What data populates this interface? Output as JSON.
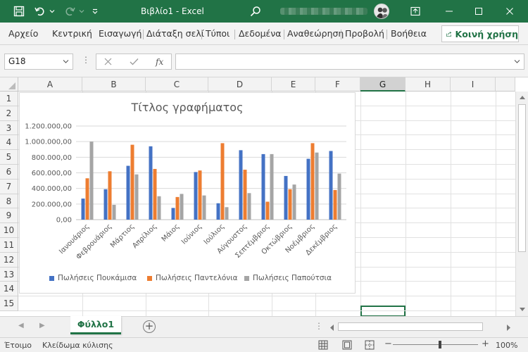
{
  "window": {
    "title": "Βιβλίο1  -  Excel"
  },
  "ribbon": {
    "tabs": [
      "Αρχείο",
      "Κεντρική",
      "Εισαγωγή",
      "Διάταξη σελί",
      "Τύποι",
      "Δεδομένα",
      "Αναθεώρηση",
      "Προβολή",
      "Βοήθεια"
    ],
    "share_label": "Κοινή χρήση"
  },
  "formula_bar": {
    "name_box": "G18",
    "fx_label": "fx",
    "formula": ""
  },
  "grid": {
    "columns": [
      "A",
      "B",
      "C",
      "D",
      "E",
      "F",
      "G",
      "H",
      "I"
    ],
    "selected_column": "G",
    "rows": [
      "1",
      "2",
      "3",
      "4",
      "5",
      "6",
      "7",
      "8",
      "9",
      "10",
      "11",
      "12",
      "13",
      "14",
      "15"
    ]
  },
  "chart_data": {
    "type": "bar",
    "title": "Τίτλος γραφήματος",
    "categories": [
      "Ιανουάριος",
      "Φεβρουάριος",
      "Μάρτιος",
      "Απρίλιος",
      "Μάιος",
      "Ιούνιος",
      "Ιούλιος",
      "Αύγουστος",
      "Σεπτέμβριος",
      "Οκτώβριος",
      "Νοέμβριος",
      "Δεκέμβριος"
    ],
    "series": [
      {
        "name": "Πωλήσεις Πουκάμισα",
        "color": "#4472C4",
        "values": [
          270000,
          390000,
          690000,
          940000,
          150000,
          610000,
          210000,
          890000,
          840000,
          560000,
          780000,
          880000
        ]
      },
      {
        "name": "Πωλήσεις Παντελόνια",
        "color": "#ED7D31",
        "values": [
          530000,
          620000,
          960000,
          650000,
          290000,
          630000,
          980000,
          640000,
          230000,
          390000,
          980000,
          380000
        ]
      },
      {
        "name": "Πωλήσεις Παπούτσια",
        "color": "#A5A5A5",
        "values": [
          1000000,
          190000,
          580000,
          300000,
          330000,
          310000,
          160000,
          340000,
          840000,
          450000,
          860000,
          590000
        ]
      }
    ],
    "yticks": [
      "0,00",
      "200.000,00",
      "400.000,00",
      "600.000,00",
      "800.000,00",
      "1.000.000,00",
      "1.200.000,00"
    ],
    "ylim": [
      0,
      1200000
    ],
    "legend_position": "bottom",
    "grid": true
  },
  "sheets": {
    "active": "Φύλλο1",
    "add_label": "+"
  },
  "status": {
    "ready": "Έτοιμο",
    "scroll_lock": "Κλείδωμα κύλισης",
    "zoom": "100%"
  }
}
